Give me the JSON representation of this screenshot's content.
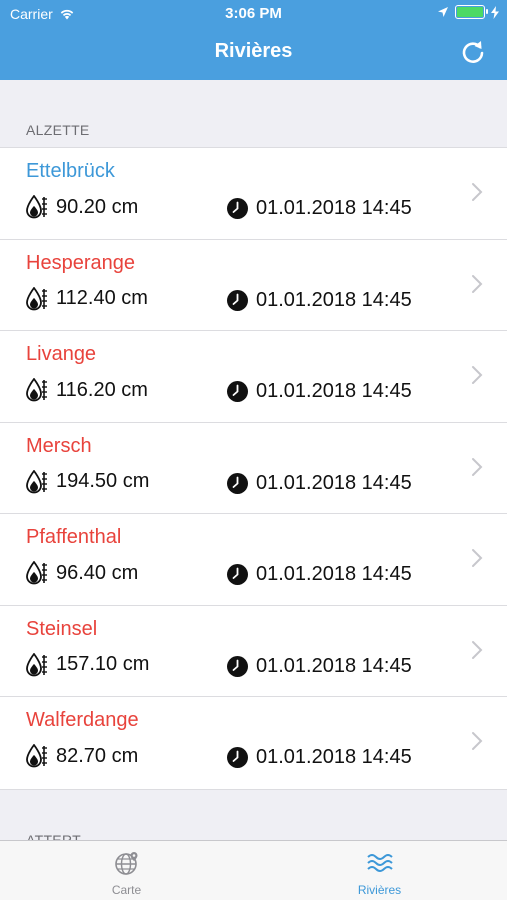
{
  "status_bar": {
    "carrier": "Carrier",
    "time": "3:06 PM"
  },
  "nav": {
    "title": "Rivières"
  },
  "sections": [
    {
      "title": "ALZETTE",
      "stations": [
        {
          "name": "Ettelbrück",
          "level": "90.20 cm",
          "time": "01.01.2018 14:45",
          "status": "normal"
        },
        {
          "name": "Hesperange",
          "level": "112.40 cm",
          "time": "01.01.2018 14:45",
          "status": "alert"
        },
        {
          "name": "Livange",
          "level": "116.20 cm",
          "time": "01.01.2018 14:45",
          "status": "alert"
        },
        {
          "name": "Mersch",
          "level": "194.50 cm",
          "time": "01.01.2018 14:45",
          "status": "alert"
        },
        {
          "name": "Pfaffenthal",
          "level": "96.40 cm",
          "time": "01.01.2018 14:45",
          "status": "alert"
        },
        {
          "name": "Steinsel",
          "level": "157.10 cm",
          "time": "01.01.2018 14:45",
          "status": "alert"
        },
        {
          "name": "Walferdange",
          "level": "82.70 cm",
          "time": "01.01.2018 14:45",
          "status": "alert"
        }
      ]
    },
    {
      "title": "ATTERT",
      "stations": []
    }
  ],
  "tabbar": {
    "items": [
      {
        "label": "Carte",
        "icon": "globe-icon",
        "active": false
      },
      {
        "label": "Rivières",
        "icon": "waves-icon",
        "active": true
      }
    ]
  },
  "colors": {
    "header": "#4a9fdf",
    "normal_station": "#3d98d8",
    "alert_station": "#e8433c",
    "active_tab": "#3d98d8",
    "inactive_tab": "#8e8e93"
  }
}
